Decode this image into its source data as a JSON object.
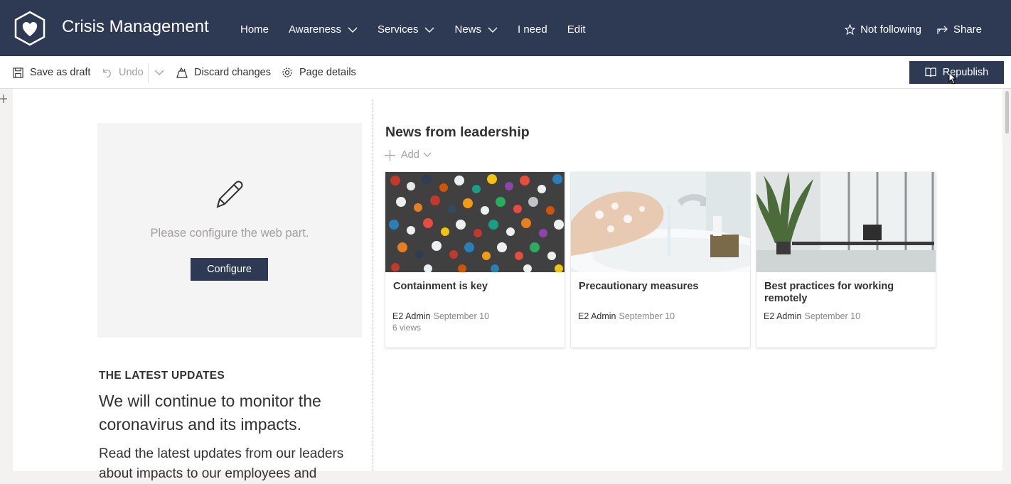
{
  "header": {
    "site_title": "Crisis Management",
    "nav": [
      {
        "label": "Home",
        "has_dropdown": false
      },
      {
        "label": "Awareness",
        "has_dropdown": true
      },
      {
        "label": "Services",
        "has_dropdown": true
      },
      {
        "label": "News",
        "has_dropdown": true
      },
      {
        "label": "I need",
        "has_dropdown": false
      },
      {
        "label": "Edit",
        "has_dropdown": false
      }
    ],
    "follow_label": "Not following",
    "share_label": "Share",
    "bg_color": "#2e3a54"
  },
  "toolbar": {
    "save_draft": "Save as draft",
    "undo": "Undo",
    "discard": "Discard changes",
    "page_details": "Page details",
    "republish": "Republish"
  },
  "placeholder": {
    "message": "Please configure the web part.",
    "button": "Configure"
  },
  "latest": {
    "heading": "THE LATEST UPDATES",
    "title": "We will continue to monitor the coronavirus and its impacts.",
    "body": "Read the latest updates from our leaders about impacts to our employees and"
  },
  "news": {
    "title": "News from leadership",
    "add_label": "Add",
    "cards": [
      {
        "title": "Containment is key",
        "author": "E2 Admin",
        "date": "September 10",
        "views": "6 views",
        "image": "traffic-crowd-image"
      },
      {
        "title": "Precautionary measures",
        "author": "E2 Admin",
        "date": "September 10",
        "views": "",
        "image": "hand-washing-image"
      },
      {
        "title": "Best practices for working remotely",
        "author": "E2 Admin",
        "date": "September 10",
        "views": "",
        "image": "office-workspace-image"
      }
    ]
  }
}
